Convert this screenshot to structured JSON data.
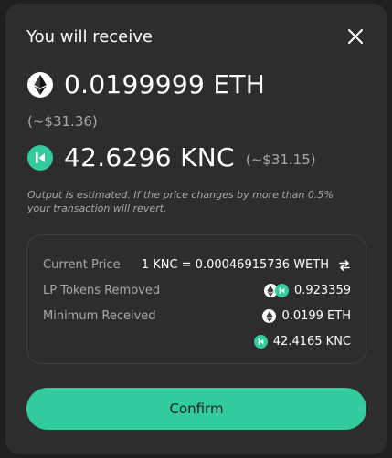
{
  "modal": {
    "title": "You will receive"
  },
  "receive": {
    "eth": {
      "amount": "0.0199999",
      "symbol": "ETH",
      "usd": "(~$31.36)",
      "icon": "eth-icon"
    },
    "knc": {
      "amount": "42.6296",
      "symbol": "KNC",
      "usd": "(~$31.15)",
      "icon": "knc-icon"
    }
  },
  "note": "Output is estimated. If the price changes by more than 0.5% your transaction will revert.",
  "info": {
    "current_price_label": "Current Price",
    "current_price_value": "1 KNC = 0.00046915736 WETH",
    "lp_removed_label": "LP Tokens Removed",
    "lp_removed_value": "0.923359",
    "min_received_label": "Minimum Received",
    "min_received_eth": "0.0199 ETH",
    "min_received_knc": "42.4165 KNC"
  },
  "confirm_label": "Confirm",
  "colors": {
    "accent": "#31cb9e",
    "background": "#2d2d2d",
    "muted_text": "#a9a9a9"
  }
}
